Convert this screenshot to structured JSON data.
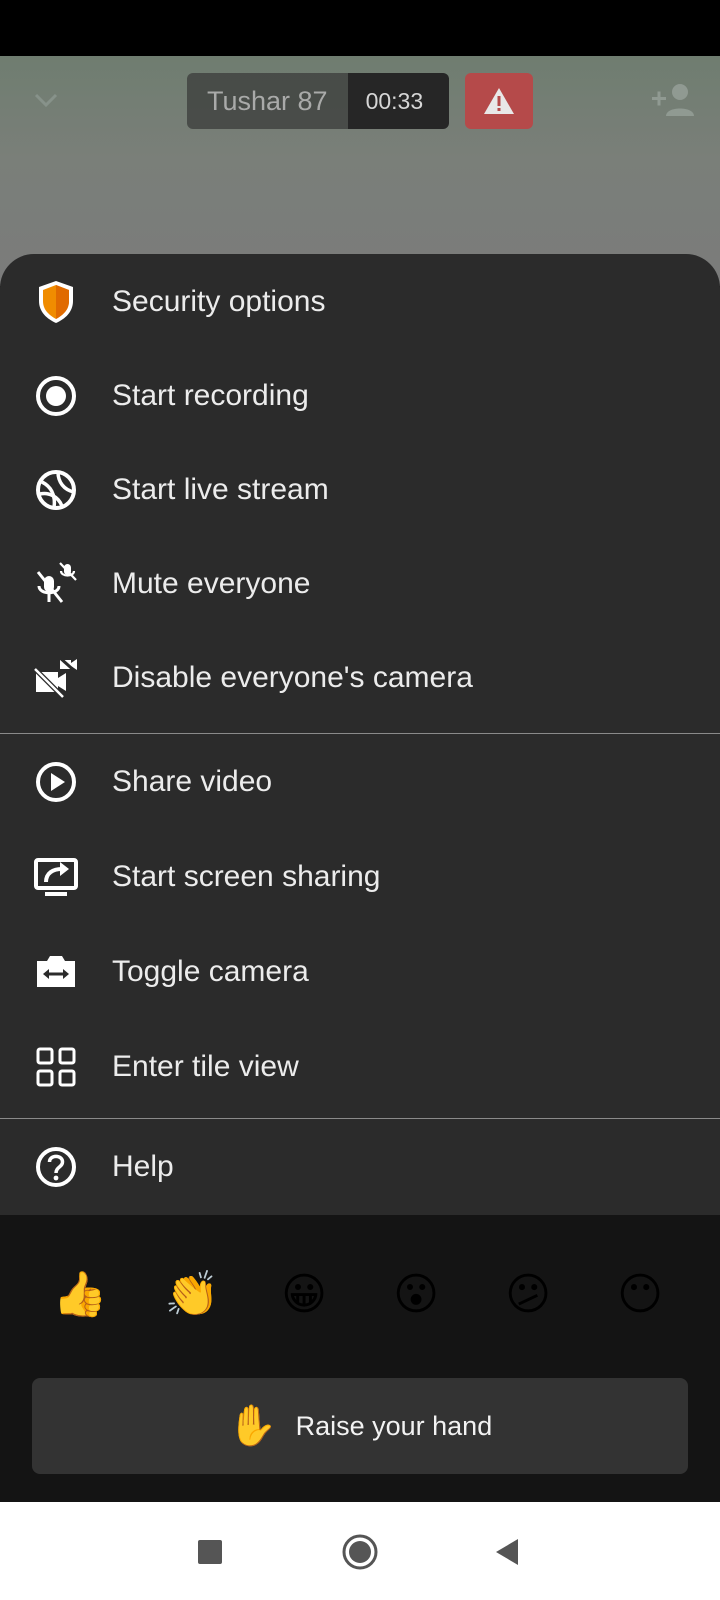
{
  "header": {
    "room_name": "Tushar 87",
    "timer": "00:33",
    "alert_color": "#b54a4a"
  },
  "menu": {
    "items": [
      {
        "label": "Security options",
        "icon": "shield-icon"
      },
      {
        "label": "Start recording",
        "icon": "record-icon"
      },
      {
        "label": "Start live stream",
        "icon": "globe-icon"
      },
      {
        "label": "Mute everyone",
        "icon": "mic-off-icon"
      },
      {
        "label": "Disable everyone's camera",
        "icon": "camera-off-icon"
      },
      {
        "label": "Share video",
        "icon": "play-icon"
      },
      {
        "label": "Start screen sharing",
        "icon": "screen-share-icon"
      },
      {
        "label": "Toggle camera",
        "icon": "camera-switch-icon"
      },
      {
        "label": "Enter tile view",
        "icon": "tile-view-icon"
      },
      {
        "label": "Help",
        "icon": "help-icon"
      }
    ]
  },
  "reactions": {
    "emojis": [
      "👍",
      "👏",
      "😀",
      "😮",
      "😕",
      "😶"
    ],
    "emoji_names": [
      "thumbs-up",
      "clap",
      "grin",
      "surprised",
      "confused",
      "no-mouth"
    ],
    "raise_hand_emoji": "✋",
    "raise_hand_label": "Raise your hand"
  },
  "colors": {
    "sheet_background": "#2b2b2b",
    "reaction_background": "#141414",
    "shield_orange": "#f08c00"
  }
}
